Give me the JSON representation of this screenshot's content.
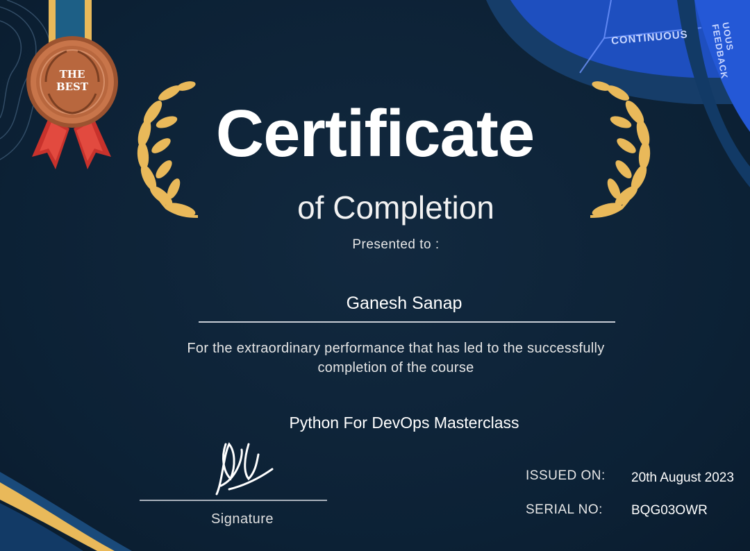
{
  "certificate": {
    "title": "Certificate",
    "subtitle": "of Completion",
    "presented_label": "Presented to :",
    "recipient_name": "Ganesh Sanap",
    "description_line1": "For the extraordinary performance that has led to the successfully",
    "description_line2": "completion of the course",
    "course_name": "Python For DevOps Masterclass",
    "signature_label": "Signature",
    "issued_on_label": "ISSUED ON:",
    "issued_on_value": "20th August 2023",
    "serial_no_label": "SERIAL NO:",
    "serial_no_value": "BQG03OWR"
  },
  "badge": {
    "line1": "THE",
    "line2": "BEST"
  },
  "decor": {
    "curve_text_1": "CONTINUOUS",
    "curve_text_2": "UOUS FEEDBACK"
  },
  "colors": {
    "background": "#0e2438",
    "accent_gold": "#e9b95a",
    "ribbon_red": "#c8322c",
    "medal_copper": "#b8673e",
    "blue_arc": "#1e4fbf"
  }
}
